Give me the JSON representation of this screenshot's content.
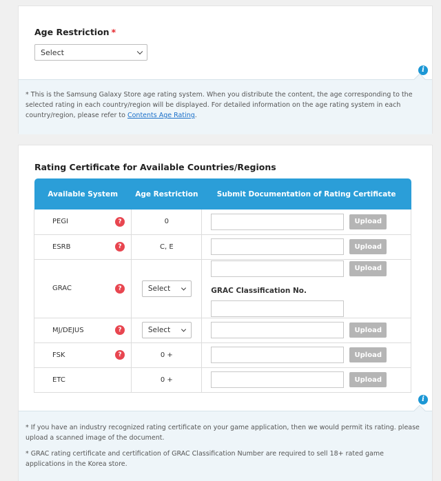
{
  "age_section": {
    "title": "Age Restriction",
    "required_mark": "*",
    "select_value": "Select",
    "note_text": "* This is the Samsung Galaxy Store age rating system. When you distribute the content, the age corresponding to the selected rating in each country/region will be displayed. For detailed information on the age rating system in each country/region, please refer to ",
    "note_link": "Contents Age Rating",
    "note_end": "."
  },
  "cert_section": {
    "title": "Rating Certificate for Available Countries/Regions",
    "headers": [
      "Available System",
      "Age Restriction",
      "Submit Documentation of Rating Certificate"
    ],
    "upload_label": "Upload",
    "select_label": "Select",
    "grac_label": "GRAC Classification No.",
    "rows": [
      {
        "system": "PEGI",
        "age": "0"
      },
      {
        "system": "ESRB",
        "age": "C, E"
      },
      {
        "system": "GRAC",
        "age": ""
      },
      {
        "system": "MJ/DEJUS",
        "age": ""
      },
      {
        "system": "FSK",
        "age": "0 +"
      },
      {
        "system": "ETC",
        "age": "0 +"
      }
    ],
    "notes": [
      "* If you have an industry recognized rating certificate on your game application, then we would permit its rating. please upload a scanned image of the document.",
      "* GRAC rating certificate and certification of GRAC Classification Number are required to sell 18+ rated game applications in the Korea store."
    ]
  },
  "icons": {
    "info": "i",
    "help": "?"
  },
  "colors": {
    "header_blue": "#2b9ed8",
    "required_red": "#e5262b",
    "help_red": "#e84650",
    "upload_gray": "#b5b5b5",
    "info_blue": "#1c97d5"
  }
}
